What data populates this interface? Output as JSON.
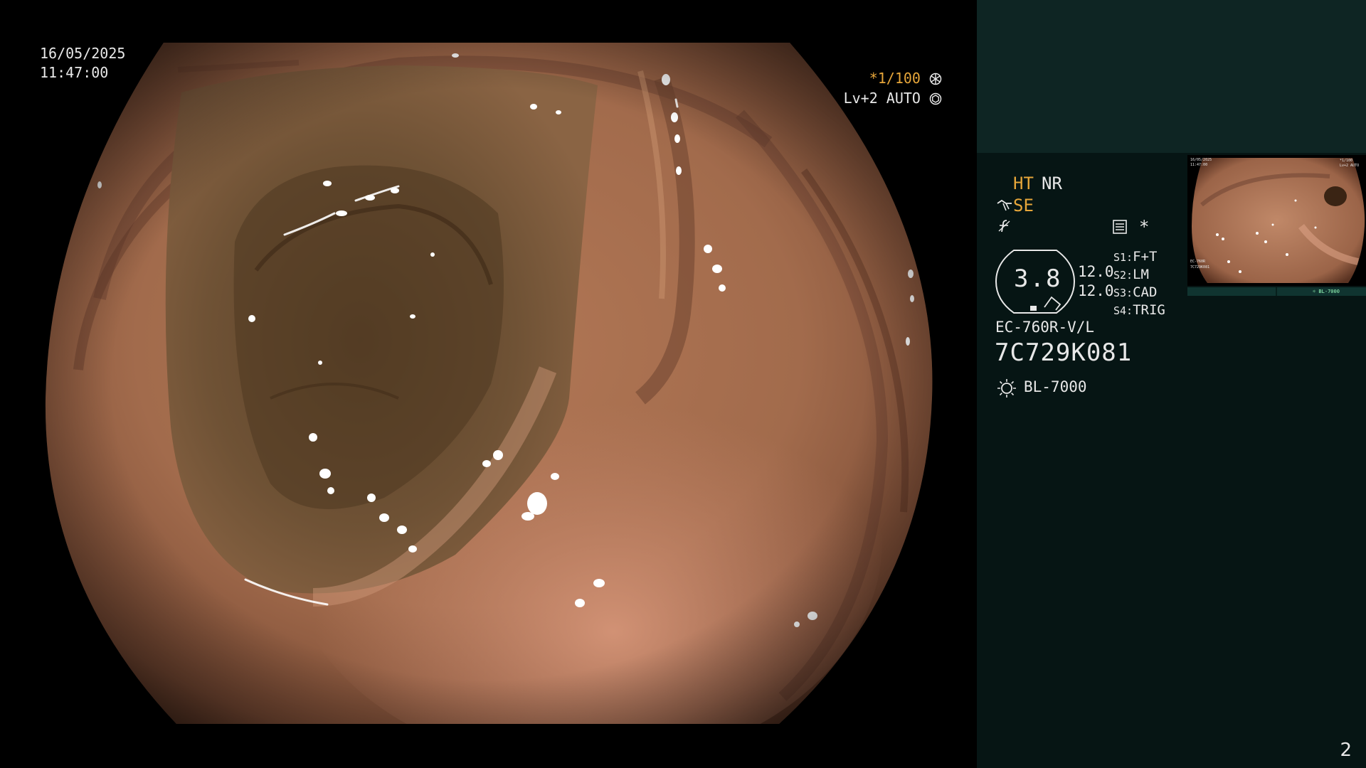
{
  "overlay": {
    "date": "16/05/2025",
    "time": "11:47:00",
    "shutter": "*1/100",
    "shutter_icon": "shutter-icon",
    "level": "Lv+2 AUTO",
    "level_icon": "iris-icon"
  },
  "panel": {
    "ht": "HT",
    "nr": "NR",
    "se": "SE",
    "se_icon": "scope-icon",
    "f_icon": "struck-f-icon",
    "list_icon": "list-icon",
    "star": "*",
    "gauge_value": "3.8",
    "values": [
      "12.0",
      "12.0"
    ],
    "switches": [
      {
        "label": "S1:",
        "value": "F+T"
      },
      {
        "label": "S2:",
        "value": "LM"
      },
      {
        "label": "S3:",
        "value": "CAD"
      },
      {
        "label": "S4:",
        "value": "TRIG"
      }
    ],
    "model": "EC-760R-V/L",
    "serial": "7C729K081",
    "lamp_icon": "bulb-icon",
    "lamp": "BL-7000"
  },
  "page_number": "2",
  "colors": {
    "panel_bg": "#061514",
    "panel_top_bg": "#0e2523",
    "accent": "#e7a63a",
    "text": "#e8e8e8"
  }
}
